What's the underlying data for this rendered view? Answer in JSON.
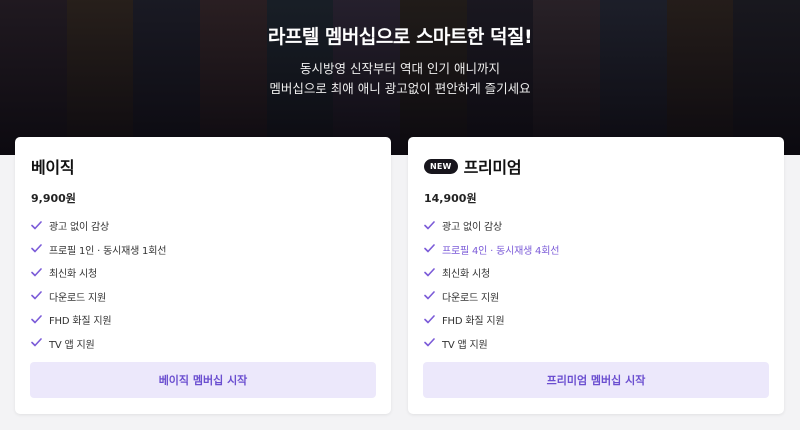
{
  "hero": {
    "title": "라프텔 멤버십으로 스마트한 덕질!",
    "subtitle_line1": "동시방영 신작부터 역대 인기 애니까지",
    "subtitle_line2": "멤버십으로 최애 애니 광고없이 편안하게 즐기세요"
  },
  "plans": [
    {
      "name": "베이직",
      "price": "9,900원",
      "features": [
        {
          "text": "광고 없이 감상",
          "highlight": false
        },
        {
          "text": "프로필 1인 · 동시재생 1회선",
          "highlight": false
        },
        {
          "text": "최신화 시청",
          "highlight": false
        },
        {
          "text": "다운로드 지원",
          "highlight": false
        },
        {
          "text": "FHD 화질 지원",
          "highlight": false
        },
        {
          "text": "TV 앱 지원",
          "highlight": false
        }
      ],
      "cta": "베이직 멤버십 시작"
    },
    {
      "badge": "NEW",
      "name": "프리미엄",
      "price": "14,900원",
      "features": [
        {
          "text": "광고 없이 감상",
          "highlight": false
        },
        {
          "text": "프로필 4인 · 동시재생 4회선",
          "highlight": true
        },
        {
          "text": "최신화 시청",
          "highlight": false
        },
        {
          "text": "다운로드 지원",
          "highlight": false
        },
        {
          "text": "FHD 화질 지원",
          "highlight": false
        },
        {
          "text": "TV 앱 지원",
          "highlight": false
        }
      ],
      "cta": "프리미엄 멤버십 시작"
    }
  ],
  "icons": {
    "check": "check-icon"
  },
  "colors": {
    "accent": "#7b5bd8",
    "cta_bg": "#ece8fb",
    "badge_bg": "#17151c",
    "hero_bg": "#1c1a22"
  }
}
